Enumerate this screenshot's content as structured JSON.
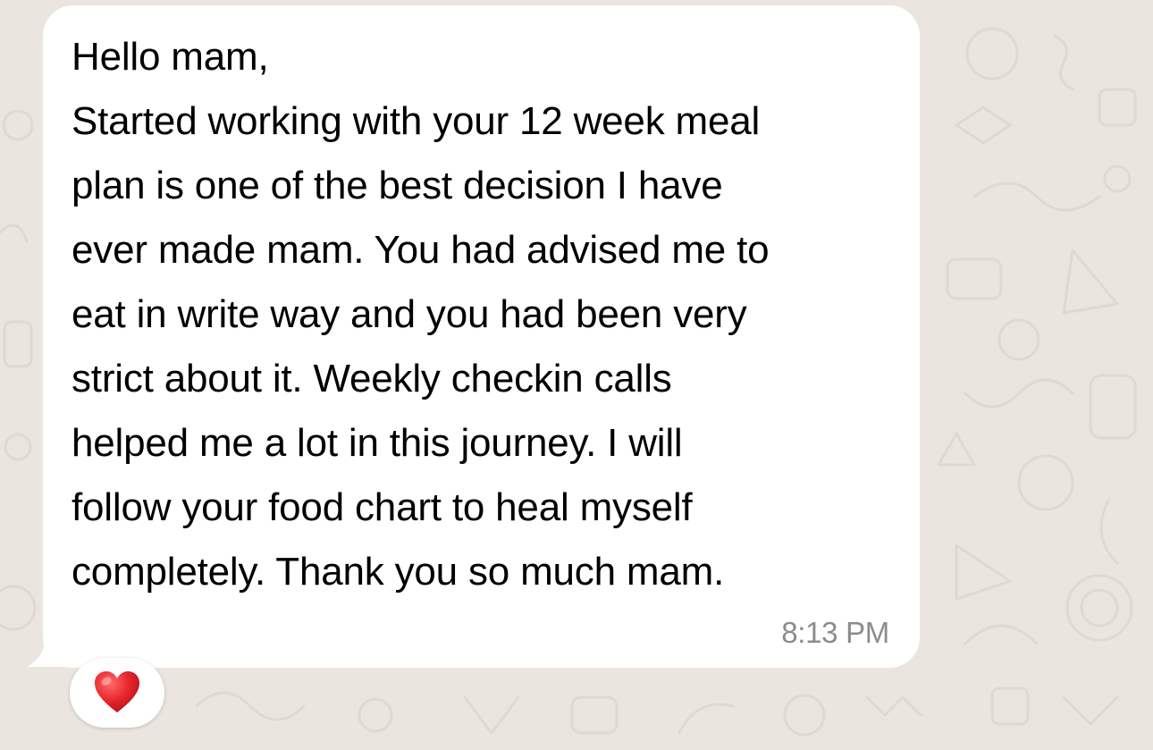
{
  "message": {
    "lines": [
      "Hello mam,",
      "Started working with your 12 week meal",
      "plan is one of the best decision I have",
      "ever made mam. You had advised me to",
      "eat in write way and you had been very",
      "strict about it. Weekly checkin calls",
      "helped me a lot in this journey. I will",
      "follow your food chart to heal myself",
      "completely. Thank you so much mam."
    ],
    "timestamp": "8:13 PM"
  },
  "reaction": {
    "icon": "red-heart-icon",
    "emoji": "❤️"
  },
  "colors": {
    "background": "#ebe5df",
    "bubble": "#ffffff",
    "text": "#000000",
    "timestamp": "#8c8c8c",
    "heart": "#e8262d"
  }
}
